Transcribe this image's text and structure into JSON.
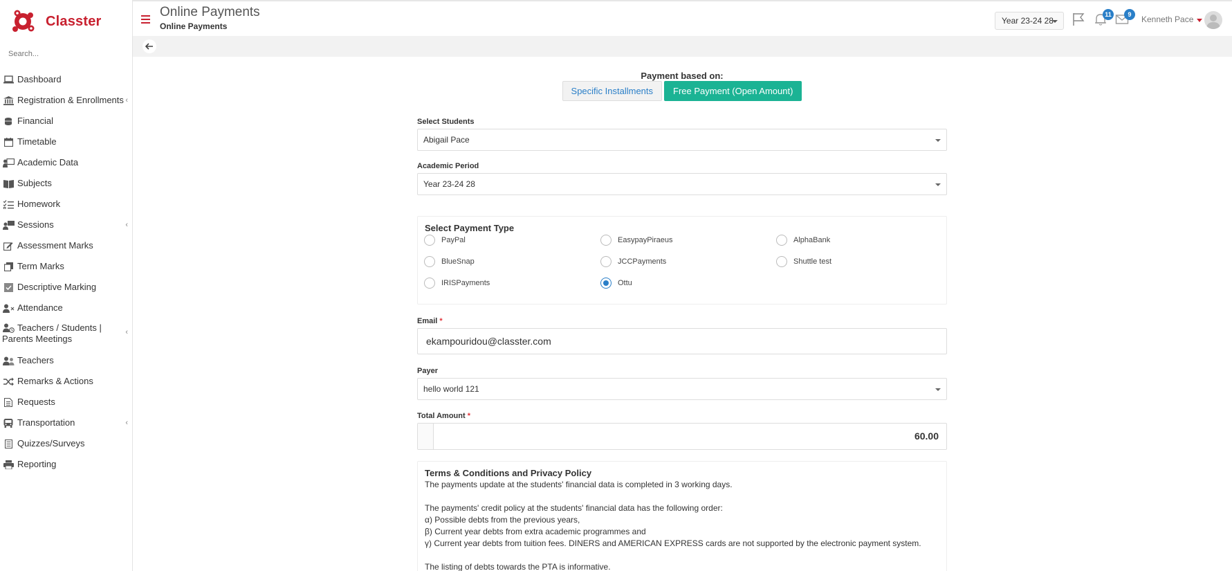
{
  "app": {
    "name": "Classter",
    "brand_color": "#c8202f",
    "accent": "#1bb394",
    "link": "#2a7fc8"
  },
  "sidebar": {
    "search_placeholder": "Search...",
    "items": [
      {
        "label": "Dashboard",
        "icon": "laptop-icon",
        "chevron": false
      },
      {
        "label": "Registration & Enrollments",
        "icon": "institution-icon",
        "chevron": true
      },
      {
        "label": "Financial",
        "icon": "coins-icon",
        "chevron": false
      },
      {
        "label": "Timetable",
        "icon": "calendar-icon",
        "chevron": false
      },
      {
        "label": "Academic Data",
        "icon": "teacher-board-icon",
        "chevron": false
      },
      {
        "label": "Subjects",
        "icon": "book-icon",
        "chevron": false
      },
      {
        "label": "Homework",
        "icon": "checklist-icon",
        "chevron": false
      },
      {
        "label": "Sessions",
        "icon": "presentation-icon",
        "chevron": true
      },
      {
        "label": "Assessment Marks",
        "icon": "edit-icon",
        "chevron": false
      },
      {
        "label": "Term Marks",
        "icon": "copy-icon",
        "chevron": false
      },
      {
        "label": "Descriptive Marking",
        "icon": "check-square-icon",
        "chevron": false
      },
      {
        "label": "Attendance",
        "icon": "user-x-icon",
        "chevron": false
      },
      {
        "label": "Teachers / Students | Parents Meetings",
        "icon": "user-clock-icon",
        "chevron": true
      },
      {
        "label": "Teachers",
        "icon": "users-icon",
        "chevron": false
      },
      {
        "label": "Remarks & Actions",
        "icon": "shuffle-icon",
        "chevron": false
      },
      {
        "label": "Requests",
        "icon": "document-icon",
        "chevron": false
      },
      {
        "label": "Transportation",
        "icon": "bus-icon",
        "chevron": true
      },
      {
        "label": "Quizzes/Surveys",
        "icon": "list-icon",
        "chevron": false
      },
      {
        "label": "Reporting",
        "icon": "printer-icon",
        "chevron": false
      }
    ]
  },
  "header": {
    "title": "Online Payments",
    "subtitle": "Online Payments",
    "year": "Year 23-24 28",
    "notifications_count": "11",
    "messages_count": "9",
    "user_name": "Kenneth Pace"
  },
  "form": {
    "payment_based_on_label": "Payment based on:",
    "btn_specific": "Specific Installments",
    "btn_free": "Free Payment (Open Amount)",
    "students_label": "Select Students",
    "students_value": "Abigail Pace",
    "period_label": "Academic Period",
    "period_value": "Year 23-24 28",
    "payment_type_title": "Select Payment Type",
    "payment_types": [
      {
        "label": "PayPal",
        "checked": false
      },
      {
        "label": "EasypayPiraeus",
        "checked": false
      },
      {
        "label": "AlphaBank",
        "checked": false
      },
      {
        "label": "BlueSnap",
        "checked": false
      },
      {
        "label": "JCCPayments",
        "checked": false
      },
      {
        "label": "Shuttle test",
        "checked": false
      },
      {
        "label": "IRISPayments",
        "checked": false
      },
      {
        "label": "Ottu",
        "checked": true
      }
    ],
    "email_label": "Email",
    "email_value": "ekampouridou@classter.com",
    "payer_label": "Payer",
    "payer_value": "hello world 121",
    "amount_label": "Total Amount",
    "amount_value": "60.00",
    "required_mark": "*"
  },
  "terms": {
    "title": "Terms & Conditions and Privacy Policy",
    "line1": "The payments update at the students' financial data is completed in 3 working days.",
    "line2": "The payments' credit policy at the students' financial data has the following order:",
    "line3": " α) Possible debts from the previous years,",
    "line4": " β) Current year debts from extra academic programmes and",
    "line5": " γ) Current year debts from tuition fees. DINERS and AMERICAN EXPRESS cards are not supported by the electronic payment system.",
    "line6": "The listing of debts towards the PTA is informative."
  }
}
